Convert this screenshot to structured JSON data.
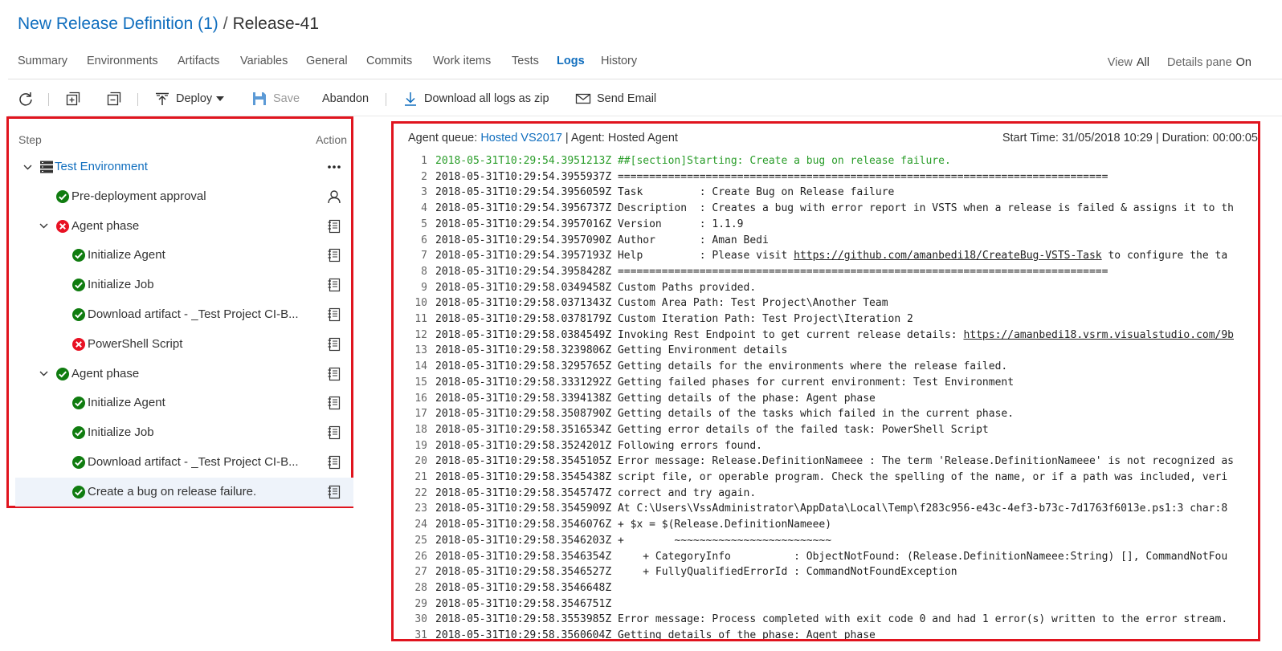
{
  "breadcrumb": {
    "definition": "New Release Definition (1)",
    "separator": "/",
    "release": "Release-41"
  },
  "tabs": [
    {
      "label": "Summary",
      "active": false
    },
    {
      "label": "Environments",
      "active": false
    },
    {
      "label": "Artifacts",
      "active": false
    },
    {
      "label": "Variables",
      "active": false
    },
    {
      "label": "General",
      "active": false
    },
    {
      "label": "Commits",
      "active": false
    },
    {
      "label": "Work items",
      "active": false
    },
    {
      "label": "Tests",
      "active": false
    },
    {
      "label": "Logs",
      "active": true
    },
    {
      "label": "History",
      "active": false
    }
  ],
  "view": {
    "label": "View",
    "value": "All"
  },
  "details_pane": {
    "label": "Details pane",
    "value": "On"
  },
  "toolbar": {
    "deploy": "Deploy",
    "save": "Save",
    "abandon": "Abandon",
    "download": "Download all logs as zip",
    "send_email": "Send Email"
  },
  "steps_panel": {
    "step_header": "Step",
    "action_header": "Action"
  },
  "tree": [
    {
      "label": "Test Environment",
      "level": 0,
      "status": "environment",
      "action": "more",
      "link": true,
      "chevron": true
    },
    {
      "label": "Pre-deployment approval",
      "level": 1,
      "status": "success",
      "action": "person"
    },
    {
      "label": "Agent phase",
      "level": 1,
      "status": "failed",
      "action": "log",
      "chevron": true
    },
    {
      "label": "Initialize Agent",
      "level": 2,
      "status": "success",
      "action": "log"
    },
    {
      "label": "Initialize Job",
      "level": 2,
      "status": "success",
      "action": "log"
    },
    {
      "label": "Download artifact - _Test Project CI-B...",
      "level": 2,
      "status": "success",
      "action": "log"
    },
    {
      "label": "PowerShell Script",
      "level": 2,
      "status": "failed",
      "action": "log"
    },
    {
      "label": "Agent phase",
      "level": 1,
      "status": "success",
      "action": "log",
      "chevron": true
    },
    {
      "label": "Initialize Agent",
      "level": 2,
      "status": "success",
      "action": "log"
    },
    {
      "label": "Initialize Job",
      "level": 2,
      "status": "success",
      "action": "log"
    },
    {
      "label": "Download artifact - _Test Project CI-B...",
      "level": 2,
      "status": "success",
      "action": "log"
    },
    {
      "label": "Create a bug on release failure.",
      "level": 2,
      "status": "success",
      "action": "log",
      "selected": true
    }
  ],
  "log_header": {
    "queue_label": "Agent queue:",
    "queue_value": "Hosted VS2017",
    "agent_label": "| Agent: Hosted Agent",
    "start_time": "Start Time: 31/05/2018 10:29 | Duration: 00:00:05"
  },
  "log_lines": [
    {
      "n": "1",
      "t": "2018-05-31T10:29:54.3951213Z ##[section]Starting: Create a bug on release failure.",
      "green": true
    },
    {
      "n": "2",
      "t": "2018-05-31T10:29:54.3955937Z =============================================================================="
    },
    {
      "n": "3",
      "t": "2018-05-31T10:29:54.3956059Z Task         : Create Bug on Release failure"
    },
    {
      "n": "4",
      "t": "2018-05-31T10:29:54.3956737Z Description  : Creates a bug with error report in VSTS when a release is failed & assigns it to th"
    },
    {
      "n": "5",
      "t": "2018-05-31T10:29:54.3957016Z Version      : 1.1.9"
    },
    {
      "n": "6",
      "t": "2018-05-31T10:29:54.3957090Z Author       : Aman Bedi"
    },
    {
      "n": "7",
      "t": "2018-05-31T10:29:54.3957193Z Help         : Please visit ",
      "link": "https://github.com/amanbedi18/CreateBug-VSTS-Task",
      "after": " to configure the ta"
    },
    {
      "n": "8",
      "t": "2018-05-31T10:29:54.3958428Z =============================================================================="
    },
    {
      "n": "9",
      "t": "2018-05-31T10:29:58.0349458Z Custom Paths provided."
    },
    {
      "n": "10",
      "t": "2018-05-31T10:29:58.0371343Z Custom Area Path: Test Project\\Another Team"
    },
    {
      "n": "11",
      "t": "2018-05-31T10:29:58.0378179Z Custom Iteration Path: Test Project\\Iteration 2"
    },
    {
      "n": "12",
      "t": "2018-05-31T10:29:58.0384549Z Invoking Rest Endpoint to get current release details: ",
      "link": "https://amanbedi18.vsrm.visualstudio.com/9b",
      "after": ""
    },
    {
      "n": "13",
      "t": "2018-05-31T10:29:58.3239806Z Getting Environment details"
    },
    {
      "n": "14",
      "t": "2018-05-31T10:29:58.3295765Z Getting details for the environments where the release failed."
    },
    {
      "n": "15",
      "t": "2018-05-31T10:29:58.3331292Z Getting failed phases for current environment: Test Environment"
    },
    {
      "n": "16",
      "t": "2018-05-31T10:29:58.3394138Z Getting details of the phase: Agent phase"
    },
    {
      "n": "17",
      "t": "2018-05-31T10:29:58.3508790Z Getting details of the tasks which failed in the current phase."
    },
    {
      "n": "18",
      "t": "2018-05-31T10:29:58.3516534Z Getting error details of the failed task: PowerShell Script"
    },
    {
      "n": "19",
      "t": "2018-05-31T10:29:58.3524201Z Following errors found."
    },
    {
      "n": "20",
      "t": "2018-05-31T10:29:58.3545105Z Error message: Release.DefinitionNameee : The term 'Release.DefinitionNameee' is not recognized as"
    },
    {
      "n": "21",
      "t": "2018-05-31T10:29:58.3545438Z script file, or operable program. Check the spelling of the name, or if a path was included, veri"
    },
    {
      "n": "22",
      "t": "2018-05-31T10:29:58.3545747Z correct and try again."
    },
    {
      "n": "23",
      "t": "2018-05-31T10:29:58.3545909Z At C:\\Users\\VssAdministrator\\AppData\\Local\\Temp\\f283c956-e43c-4ef3-b73c-7d1763f6013e.ps1:3 char:8"
    },
    {
      "n": "24",
      "t": "2018-05-31T10:29:58.3546076Z + $x = $(Release.DefinitionNameee)"
    },
    {
      "n": "25",
      "t": "2018-05-31T10:29:58.3546203Z +        ~~~~~~~~~~~~~~~~~~~~~~~~~"
    },
    {
      "n": "26",
      "t": "2018-05-31T10:29:58.3546354Z     + CategoryInfo          : ObjectNotFound: (Release.DefinitionNameee:String) [], CommandNotFou"
    },
    {
      "n": "27",
      "t": "2018-05-31T10:29:58.3546527Z     + FullyQualifiedErrorId : CommandNotFoundException"
    },
    {
      "n": "28",
      "t": "2018-05-31T10:29:58.3546648Z"
    },
    {
      "n": "29",
      "t": "2018-05-31T10:29:58.3546751Z"
    },
    {
      "n": "30",
      "t": "2018-05-31T10:29:58.3553985Z Error message: Process completed with exit code 0 and had 1 error(s) written to the error stream."
    },
    {
      "n": "31",
      "t": "2018-05-31T10:29:58.3560604Z Getting details of the phase: Agent phase"
    }
  ],
  "colors": {
    "accent": "#106ebe",
    "success": "#107c10",
    "failed": "#e81123",
    "highlight_border": "#e0141e",
    "log_green": "#2a9d2a"
  }
}
